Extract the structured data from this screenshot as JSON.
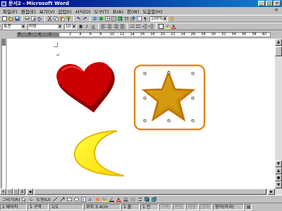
{
  "window": {
    "title": "문서2 - Microsoft Word",
    "buttons": [
      "_",
      "□",
      "×"
    ]
  },
  "menu": {
    "items": [
      "파일(F)",
      "편집(E)",
      "보기(V)",
      "삽입(I)",
      "서식(O)",
      "도구(T)",
      "표(A)",
      "창(W)",
      "도움말(H)"
    ],
    "close": "×"
  },
  "toolbar": {
    "zoom": "100%"
  },
  "formatting": {
    "style": "표준",
    "font": "바탕",
    "size": "10"
  },
  "ruler": {
    "ticks": [
      "8",
      "6",
      "4",
      "2",
      "",
      "2",
      "4",
      "6",
      "8",
      "10",
      "12",
      "14",
      "16",
      "18",
      "20",
      "22",
      "24",
      "26",
      "28",
      "30",
      "32",
      "34",
      "36",
      "38",
      "40"
    ]
  },
  "document": {
    "paragraph_mark": "↵",
    "shapes": [
      {
        "name": "heart",
        "fill": "#cc0000"
      },
      {
        "name": "star",
        "fill": "#d4a000",
        "selected": true,
        "frame": "#e08a1e"
      },
      {
        "name": "moon",
        "fill": "#ffff00",
        "stroke": "#e6b800"
      }
    ]
  },
  "drawing_toolbar": {
    "draw_label": "그리기(R)",
    "autoshapes_label": "도형(U)"
  },
  "status": {
    "page": "1 페이지",
    "section": "1 구역",
    "pages": "1/1",
    "position": "위치 3.4cm",
    "line": "1 줄",
    "column": "1 칸",
    "modes": [
      "기록",
      "변경",
      "확장",
      "겹쳐"
    ],
    "language": "영어(미국)"
  }
}
